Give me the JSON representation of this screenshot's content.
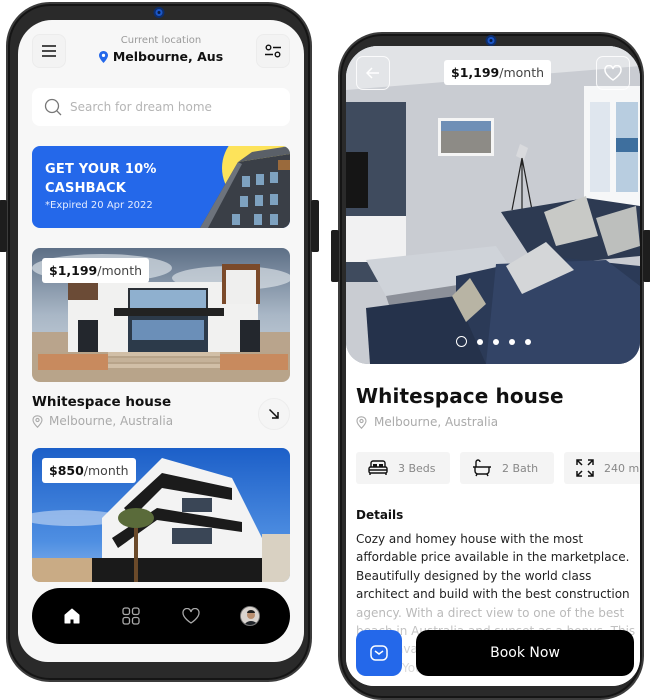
{
  "left_screen": {
    "header": {
      "location_label": "Current location",
      "location_value": "Melbourne, Aus"
    },
    "search": {
      "placeholder": "Search for dream home",
      "value": ""
    },
    "promo": {
      "title_line1": "GET YOUR 10%",
      "title_line2": "CASHBACK",
      "subtitle": "*Expired 20 Apr 2022"
    },
    "listings": [
      {
        "price": "$1,199",
        "period": "/month",
        "title": "Whitespace house",
        "location": "Melbourne, Australia"
      },
      {
        "price": "$850",
        "period": "/month"
      }
    ],
    "nav": [
      {
        "icon": "home-icon",
        "active": true
      },
      {
        "icon": "grid-icon",
        "active": false
      },
      {
        "icon": "heart-icon",
        "active": false
      },
      {
        "icon": "avatar",
        "active": false
      }
    ]
  },
  "right_screen": {
    "hero": {
      "price": "$1,199",
      "period": "/month",
      "slides_total": 5,
      "slide_active": 1
    },
    "title": "Whitespace house",
    "location": "Melbourne, Australia",
    "features": [
      {
        "icon": "bed-icon",
        "label": "3 Beds"
      },
      {
        "icon": "bathtub-icon",
        "label": "2 Bath"
      },
      {
        "icon": "area-expand-icon",
        "label": "240 m"
      }
    ],
    "details_heading": "Details",
    "details_text": "Cozy and homey house with the most affordable price available in the marketplace. Beautifully designed by the world class architect and build with the best construction agency. With a direct view to one of the best beach in Australia and sunset as a bonus. This house available with modern American style on top. You will also get a large",
    "book_label": "Book Now"
  },
  "colors": {
    "accent_blue": "#2468ea",
    "promo_yellow": "#fde35a",
    "dark": "#000000"
  }
}
